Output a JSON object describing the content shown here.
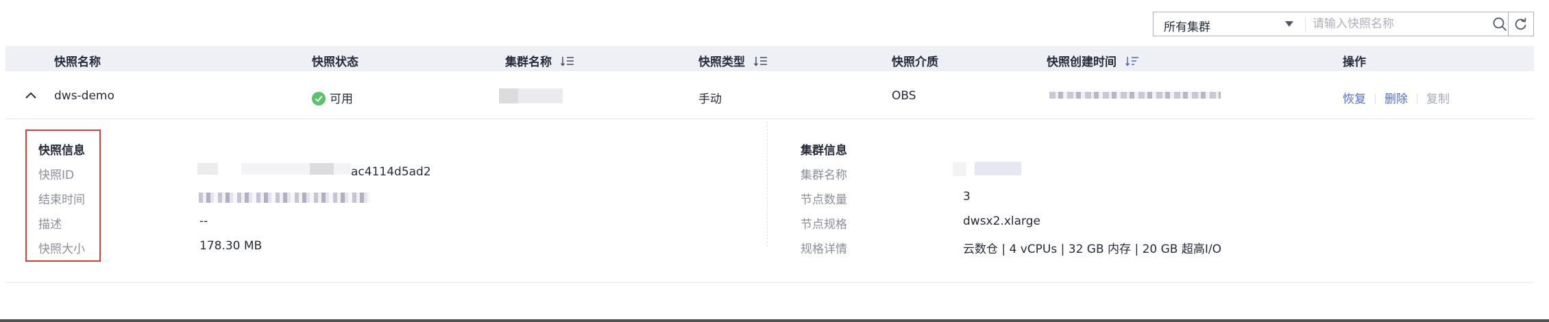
{
  "toolbar": {
    "cluster_select_value": "所有集群",
    "search_placeholder": "请输入快照名称"
  },
  "table": {
    "columns": [
      "快照名称",
      "快照状态",
      "集群名称",
      "快照类型",
      "快照介质",
      "快照创建时间",
      "操作"
    ],
    "row": {
      "name": "dws-demo",
      "status": "可用",
      "type": "手动",
      "medium": "OBS",
      "actions": [
        "恢复",
        "删除",
        "复制"
      ]
    }
  },
  "snapshot_info": {
    "title": "快照信息",
    "labels": [
      "快照ID",
      "结束时间",
      "描述",
      "快照大小"
    ],
    "id_suffix": "ac4114d5ad2",
    "description": "--",
    "size": "178.30 MB"
  },
  "cluster_info": {
    "title": "集群信息",
    "labels": [
      "集群名称",
      "节点数量",
      "节点规格",
      "规格详情"
    ],
    "node_count": "3",
    "node_spec": "dwsx2.xlarge",
    "spec_detail": "云数仓 | 4 vCPUs | 32 GB 内存 | 20 GB 超高I/O"
  },
  "colors": {
    "link": "#526ecc",
    "status_ok": "#5dc26b",
    "highlight_border": "#e03b3b",
    "header_bg": "#eef0f5"
  }
}
